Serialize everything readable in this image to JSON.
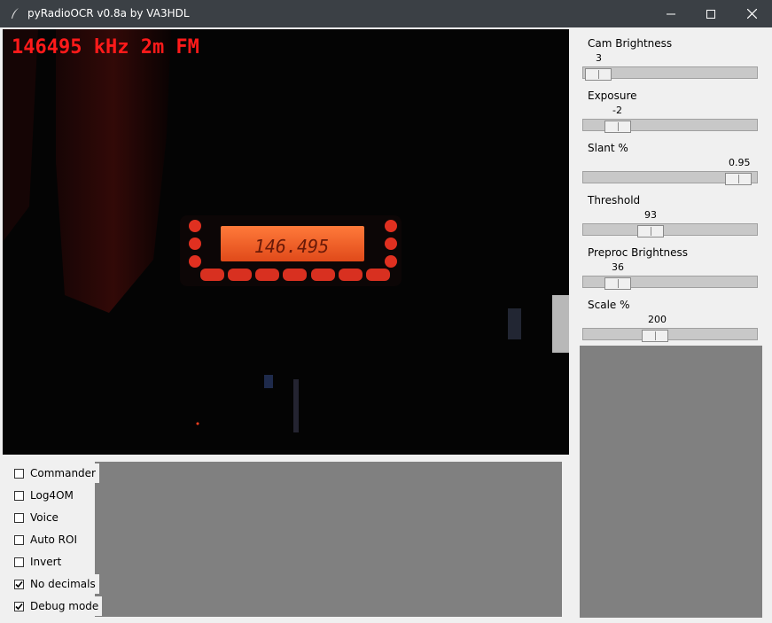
{
  "window": {
    "title": "pyRadioOCR v0.8a by VA3HDL"
  },
  "video": {
    "overlay": "146495 kHz 2m FM",
    "radio_display": "146.495"
  },
  "sliders": [
    {
      "label": "Cam Brightness",
      "value": "3",
      "position": 0.12
    },
    {
      "label": "Exposure",
      "value": "-2",
      "position": 0.2
    },
    {
      "label": "Slant %",
      "value": "0.95",
      "position": 0.95
    },
    {
      "label": "Threshold",
      "value": "93",
      "position": 0.45
    },
    {
      "label": "Preproc Brightness",
      "value": "36",
      "position": 0.2
    },
    {
      "label": "Scale %",
      "value": "200",
      "position": 0.5
    }
  ],
  "checkboxes": [
    {
      "label": "Commander",
      "checked": false
    },
    {
      "label": "Log4OM",
      "checked": false
    },
    {
      "label": "Voice",
      "checked": false
    },
    {
      "label": "Auto ROI",
      "checked": false
    },
    {
      "label": "Invert",
      "checked": false
    },
    {
      "label": "No decimals",
      "checked": true
    },
    {
      "label": "Debug mode",
      "checked": true
    }
  ]
}
